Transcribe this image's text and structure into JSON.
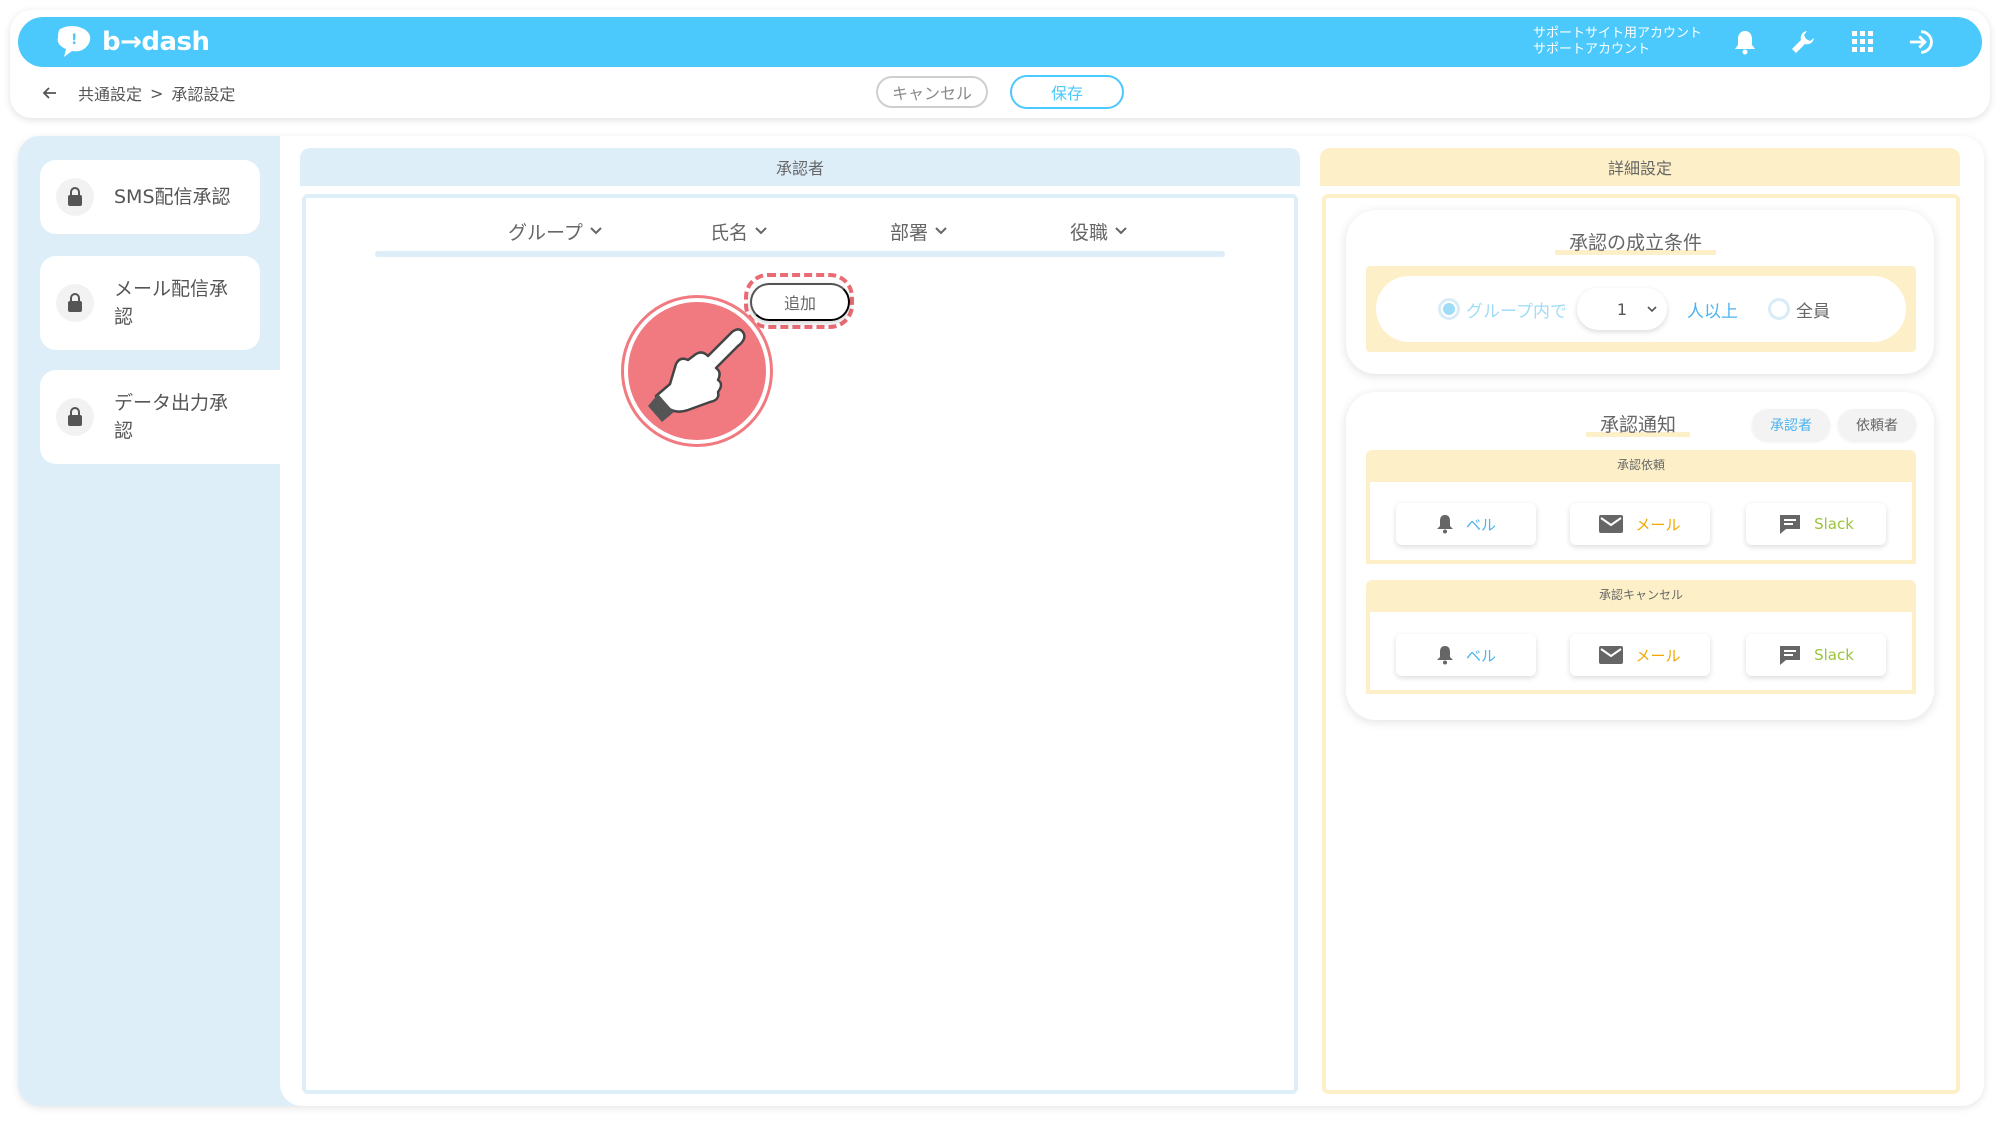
{
  "app": {
    "logo_text": "b→dash",
    "account_line1": "サポートサイト用アカウント",
    "account_line2": "サポートアカウント"
  },
  "breadcrumb": {
    "parent": "共通設定",
    "separator": ">",
    "current": "承認設定"
  },
  "actions": {
    "cancel_label": "キャンセル",
    "save_label": "保存"
  },
  "sidebar": {
    "items": [
      {
        "label": "SMS配信承認"
      },
      {
        "label": "メール配信承認"
      },
      {
        "label": "データ出力承認"
      }
    ]
  },
  "approvers": {
    "header": "承認者",
    "columns": [
      "グループ",
      "氏名",
      "部署",
      "役職"
    ],
    "add_label": "追加"
  },
  "details": {
    "header": "詳細設定",
    "condition": {
      "title": "承認の成立条件",
      "option_group": "グループ内で",
      "count_value": "1",
      "count_suffix": "人以上",
      "option_all": "全員"
    },
    "notification": {
      "title": "承認通知",
      "tab_approver": "承認者",
      "tab_requester": "依頼者",
      "request": {
        "title": "承認依頼",
        "bell": "ベル",
        "mail": "メール",
        "slack": "Slack"
      },
      "cancel": {
        "title": "承認キャンセル",
        "bell": "ベル",
        "mail": "メール",
        "slack": "Slack"
      }
    }
  },
  "colors": {
    "brand": "#4cc9fc",
    "approver_accent": "#ddeef9",
    "detail_accent": "#fdf0c8",
    "highlight": "#ea6b74",
    "mail": "#f0a800",
    "slack": "#9bc43a",
    "bell": "#4cb3f0"
  }
}
